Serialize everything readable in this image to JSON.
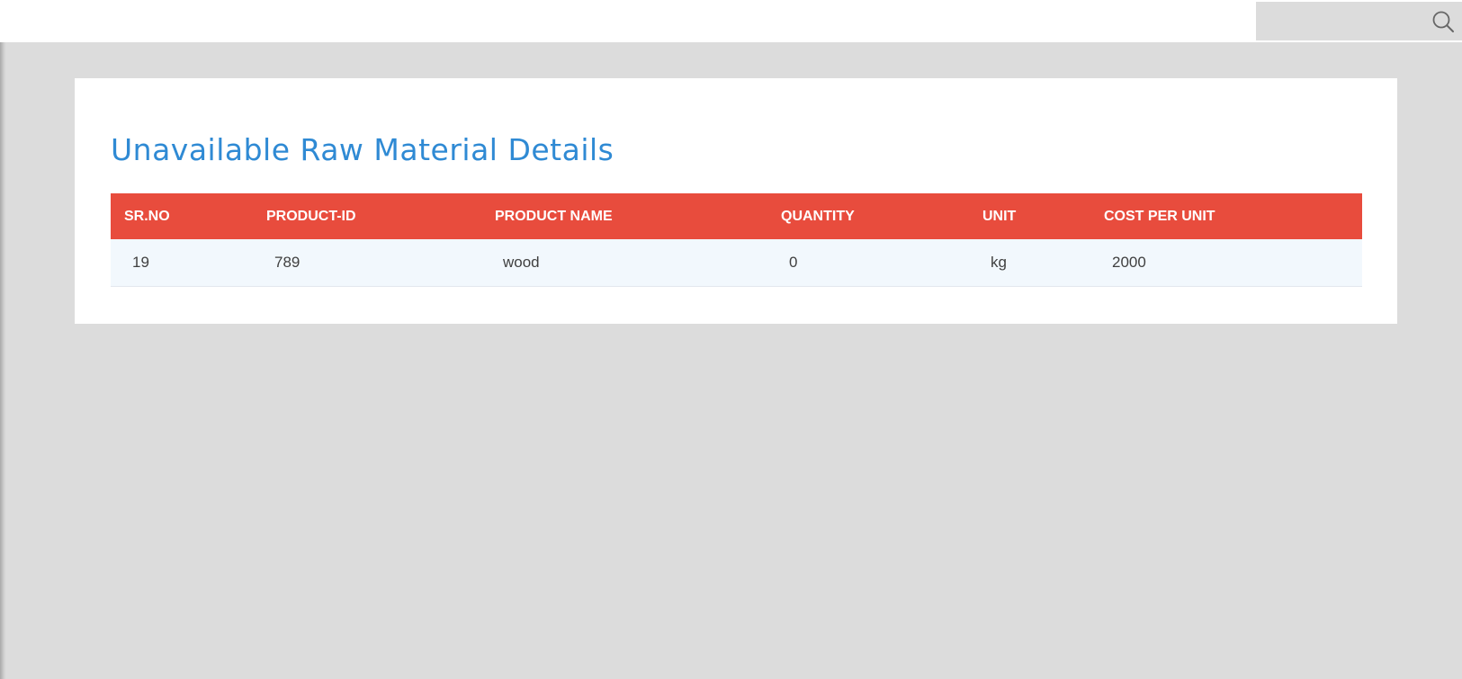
{
  "search": {
    "placeholder": "",
    "value": ""
  },
  "page": {
    "title": "Unavailable Raw Material Details"
  },
  "table": {
    "columns": [
      "SR.NO",
      "PRODUCT-ID",
      "PRODUCT NAME",
      "QUANTITY",
      "UNIT",
      "COST PER UNIT"
    ],
    "rows": [
      [
        "19",
        "789",
        "wood",
        "0",
        "kg",
        "2000"
      ]
    ]
  },
  "colors": {
    "accent": "#2f8ad4",
    "header_bg": "#e84c3d",
    "row_bg": "#f2f8fd",
    "page_bg": "#dcdcdc"
  }
}
